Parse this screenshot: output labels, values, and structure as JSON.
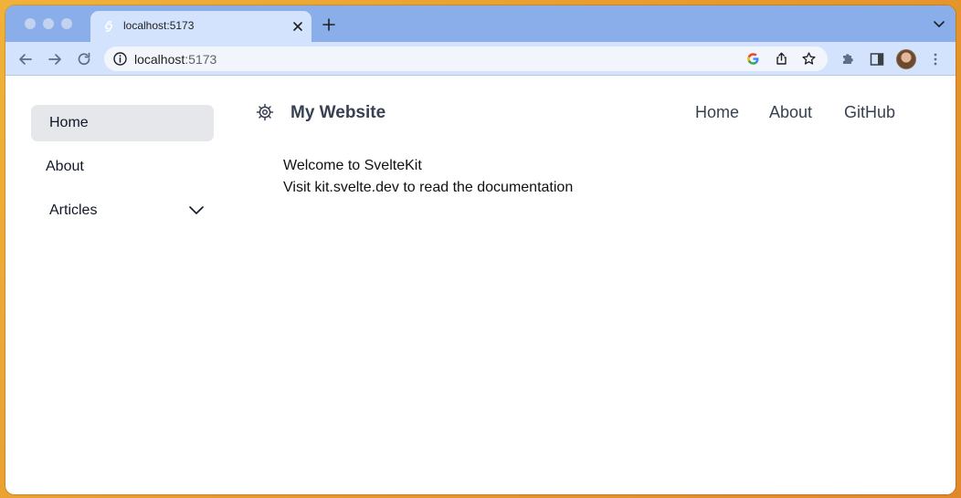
{
  "browser": {
    "tab": {
      "title": "localhost:5173"
    },
    "address": {
      "host": "localhost",
      "port": ":5173"
    }
  },
  "sidebar": {
    "items": [
      {
        "label": "Home",
        "active": true
      },
      {
        "label": "About",
        "active": false
      },
      {
        "label": "Articles",
        "active": false,
        "expandable": true
      }
    ]
  },
  "header": {
    "site_title": "My Website",
    "nav": [
      {
        "label": "Home"
      },
      {
        "label": "About"
      },
      {
        "label": "GitHub"
      }
    ]
  },
  "main": {
    "heading": "Welcome to SvelteKit",
    "body": "Visit kit.svelte.dev to read the documentation"
  },
  "colors": {
    "tabstrip": "#8aaee9",
    "toolbar": "#d3e3fd",
    "active_sidebar": "#e5e7eb",
    "svelte_logo": "#ff3e00"
  },
  "icons": [
    "svelte-favicon",
    "close-icon",
    "plus-icon",
    "chevron-down-icon",
    "back-icon",
    "forward-icon",
    "reload-icon",
    "info-icon",
    "google-icon",
    "share-icon",
    "star-icon",
    "extensions-icon",
    "side-panel-icon",
    "kebab-menu-icon",
    "gear-icon"
  ]
}
